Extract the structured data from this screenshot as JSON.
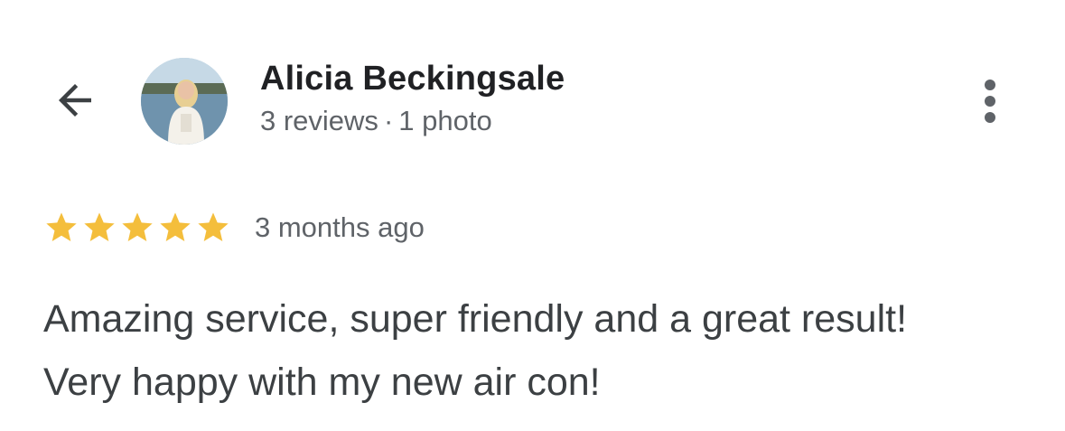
{
  "reviewer": {
    "name": "Alicia Beckingsale",
    "reviews_count": "3 reviews",
    "separator": "·",
    "photos_count": "1 photo"
  },
  "rating": {
    "stars": 5,
    "max_stars": 5,
    "star_color": "#F4BE3C",
    "date": "3 months ago"
  },
  "review": {
    "line1": "Amazing service, super friendly and a great result!",
    "line2": "Very happy with my new air con!"
  },
  "icons": {
    "back": "arrow-back-icon",
    "more": "more-vert-icon",
    "star": "star-icon"
  },
  "colors": {
    "text_primary": "#202124",
    "text_secondary": "#5f6368",
    "text_body": "#3c4043"
  }
}
